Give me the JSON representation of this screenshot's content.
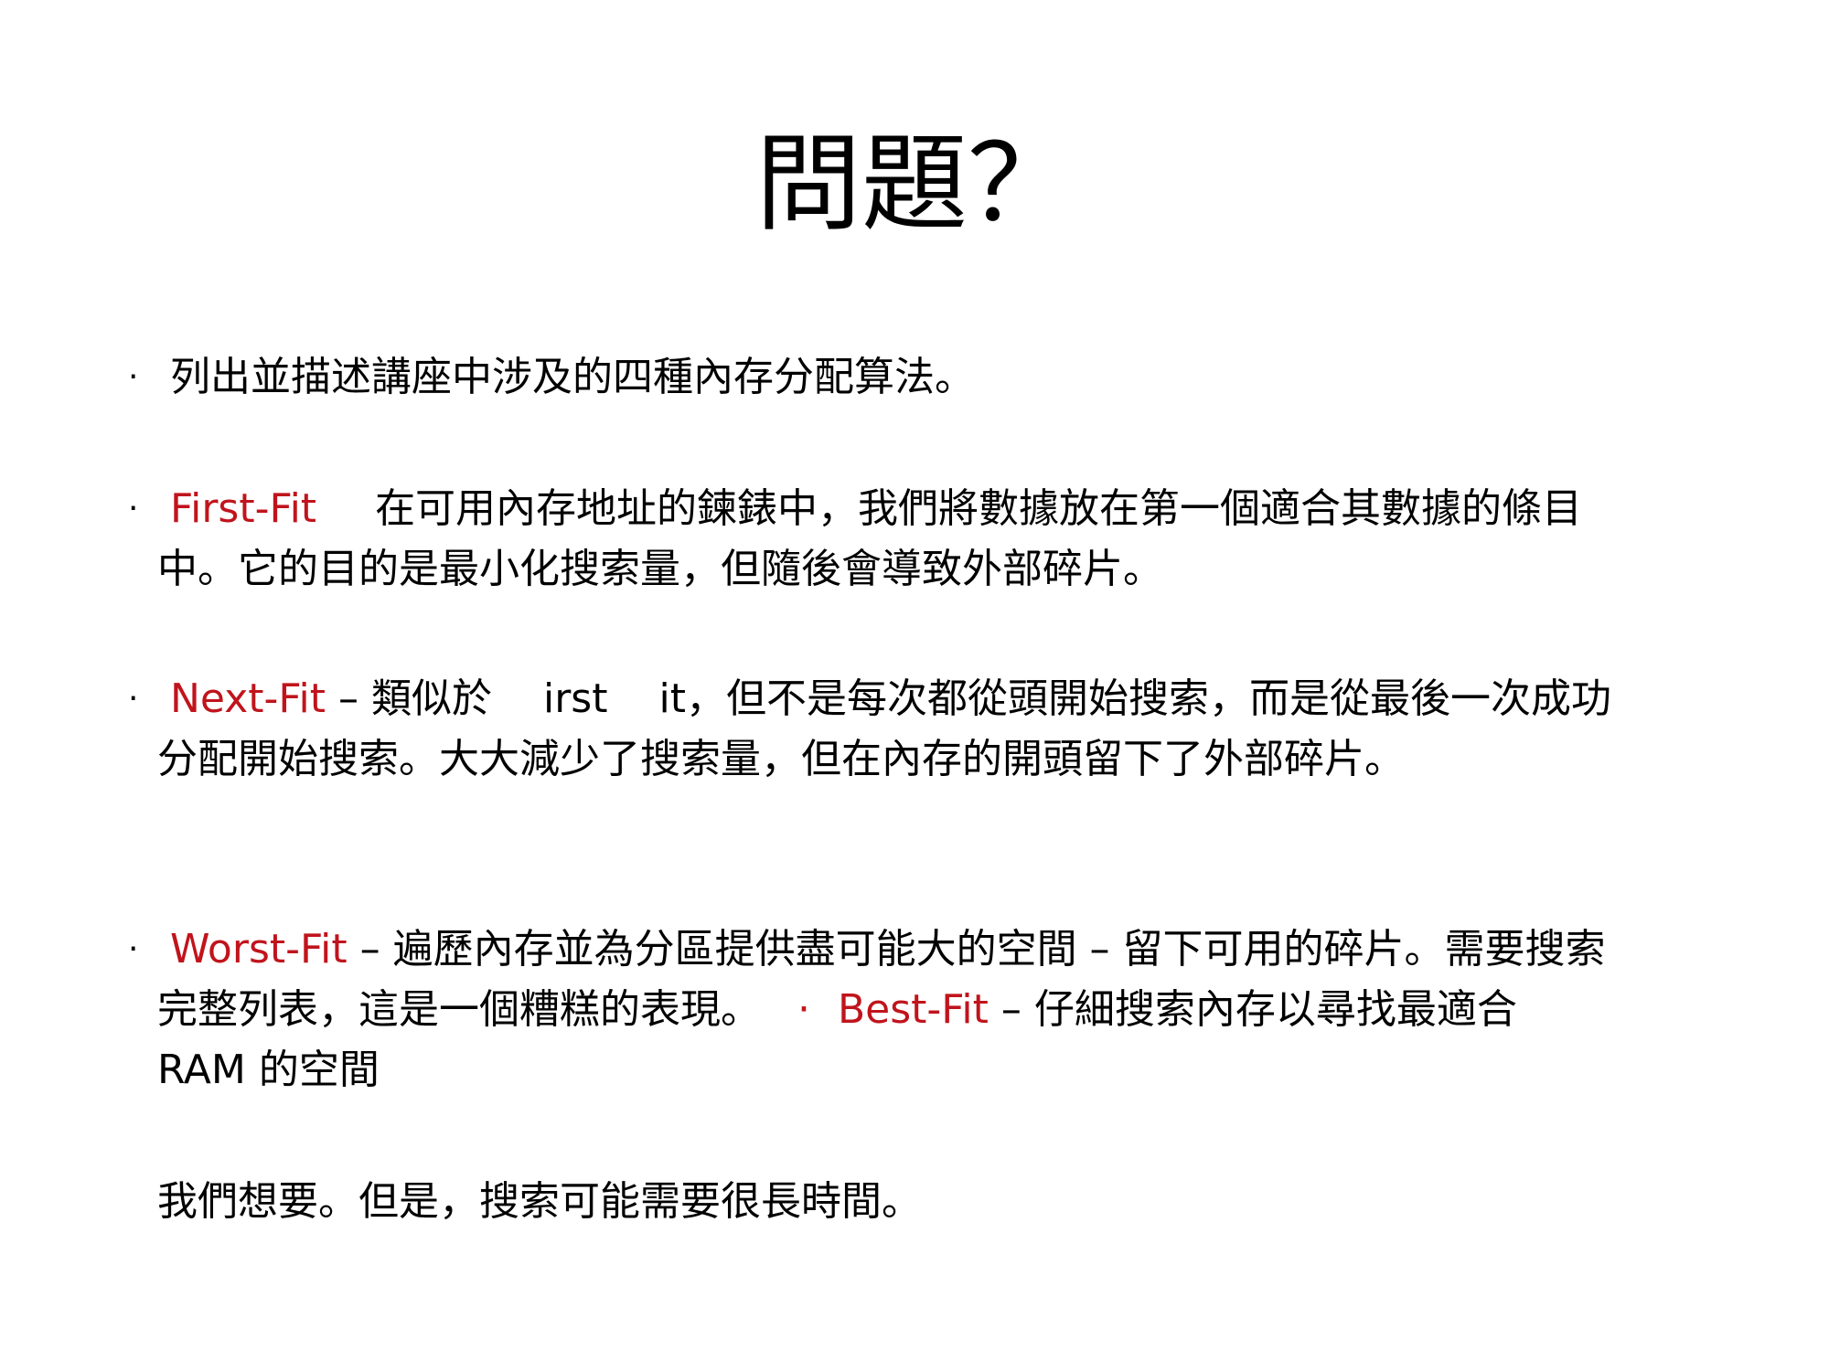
{
  "title": "問題？",
  "bullet_symbol": "·",
  "items": [
    {
      "text": "列出並描述講座中涉及的四種內存分配算法。"
    },
    {
      "term": "First-Fit",
      "line1": "在可用內存地址的鍊錶中，我們將數據放在第一個適合其數據的條目",
      "line2": "中。它的目的是最小化搜索量，但隨後會導致外部碎片。"
    },
    {
      "term": "Next-Fit",
      "line1_a": "– 類似於",
      "line1_b": "irst",
      "line1_c": "it，但不是每次都從頭開始搜索，而是從最後一次成功",
      "line2": "分配開始搜索。大大減少了搜索量，但在內存的開頭留下了外部碎片。"
    },
    {
      "term": "Worst-Fit",
      "line1": "– 遍歷內存並為分區提供盡可能大的空間 – 留下可用的碎片。需要搜索",
      "line2_a": "完整列表，這是一個糟糕的表現。",
      "term2": "Best-Fit",
      "line2_b": "– 仔細搜索內存以尋找最適合",
      "line3": "RAM 的空間"
    },
    {
      "text": "我們想要。但是，搜索可能需要很長時間。"
    }
  ],
  "colors": {
    "term": "#c0141c",
    "text": "#000000",
    "background": "#ffffff"
  }
}
